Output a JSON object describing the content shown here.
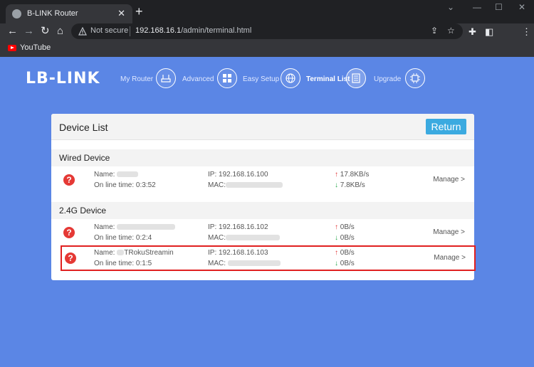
{
  "browser": {
    "tab_title": "B-LINK Router",
    "close_glyph": "✕",
    "new_tab_glyph": "+",
    "not_secure": "Not secure",
    "url_host": "192.168.16.1",
    "url_path": "/admin/terminal.html",
    "bookmark": "YouTube",
    "icons": [
      "back-icon",
      "forward-icon",
      "reload-icon",
      "home-icon",
      "warning-icon",
      "share-icon",
      "star-icon",
      "extensions-icon",
      "sidepanel-icon",
      "menu-icon"
    ]
  },
  "router": {
    "logo": "LB-LINK",
    "nav": [
      {
        "label": "My Router",
        "icon": "router-icon"
      },
      {
        "label": "Advanced",
        "icon": "grid-icon"
      },
      {
        "label": "Easy Setup",
        "icon": "globe-icon"
      },
      {
        "label": "Terminal List",
        "icon": "list-icon",
        "active": true
      },
      {
        "label": "Upgrade",
        "icon": "chip-icon"
      }
    ]
  },
  "panel": {
    "title": "Device List",
    "return_label": "Return",
    "wired_title": "Wired Device",
    "wifi_title": "2.4G Device",
    "name_label": "Name:",
    "online_label": "On line time:",
    "ip_label": "IP:",
    "mac_label": "MAC:",
    "manage_label": "Manage >",
    "up_arrow": "↑",
    "down_arrow": "↓",
    "devices": [
      {
        "name": "",
        "online": "0:3:52",
        "ip": "192.168.16.100",
        "up": "17.8KB/s",
        "down": "7.8KB/s"
      },
      {
        "name": "",
        "online": "0:2:4",
        "ip": "192.168.16.102",
        "up": "0B/s",
        "down": "0B/s"
      },
      {
        "name": "TRokuStreamin",
        "online": "0:1:5",
        "ip": "192.168.16.103",
        "up": "0B/s",
        "down": "0B/s"
      }
    ]
  },
  "colors": {
    "page_bg": "#5b86e5",
    "accent": "#3baae0",
    "highlight": "#e02020"
  }
}
